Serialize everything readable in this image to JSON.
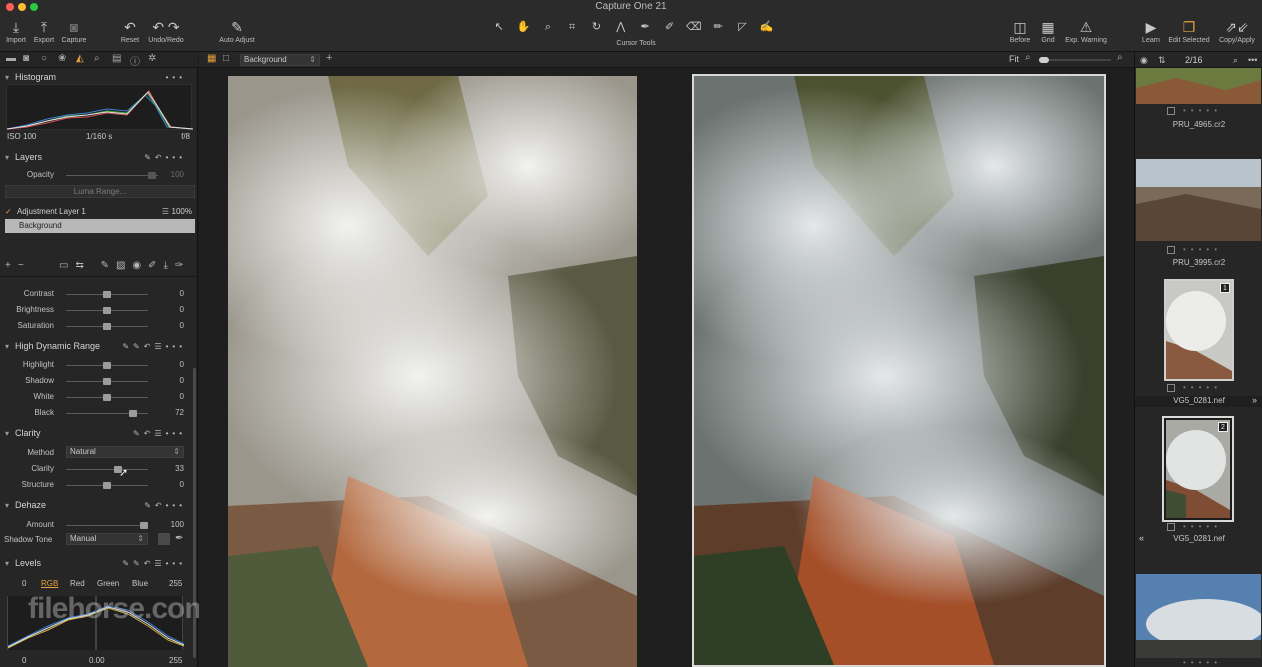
{
  "window": {
    "title": "Capture One 21"
  },
  "toolbar": {
    "left": [
      {
        "icon": "import-icon",
        "label": "Import"
      },
      {
        "icon": "export-icon",
        "label": "Export"
      },
      {
        "icon": "capture-icon",
        "label": "Capture"
      },
      {
        "icon": "reset-icon",
        "label": "Reset"
      },
      {
        "icon": "undo-redo-icon",
        "label": "Undo/Redo"
      },
      {
        "icon": "auto-adjust-icon",
        "label": "Auto Adjust"
      }
    ],
    "cursor_tools_label": "Cursor Tools",
    "right": [
      {
        "icon": "before-icon",
        "label": "Before"
      },
      {
        "icon": "grid-icon",
        "label": "Grid"
      },
      {
        "icon": "exposure-warning-icon",
        "label": "Exp. Warning"
      },
      {
        "icon": "learn-icon",
        "label": "Learn"
      },
      {
        "icon": "edit-selected-icon",
        "label": "Edit Selected"
      },
      {
        "icon": "copy-apply-icon",
        "label": "Copy/Apply"
      }
    ]
  },
  "histogram": {
    "title": "Histogram",
    "iso": "ISO 100",
    "shutter": "1/160 s",
    "aperture": "f/8"
  },
  "layers": {
    "title": "Layers",
    "opacity_label": "Opacity",
    "opacity_value": "100",
    "luma_button": "Luma Range...",
    "adjustment_layer": "Adjustment Layer 1",
    "adjustment_value": "100%",
    "background_layer": "Background"
  },
  "basic": {
    "contrast": {
      "label": "Contrast",
      "value": "0"
    },
    "brightness": {
      "label": "Brightness",
      "value": "0"
    },
    "saturation": {
      "label": "Saturation",
      "value": "0"
    }
  },
  "hdr": {
    "title": "High Dynamic Range",
    "highlight": {
      "label": "Highlight",
      "value": "0"
    },
    "shadow": {
      "label": "Shadow",
      "value": "0"
    },
    "white": {
      "label": "White",
      "value": "0"
    },
    "black": {
      "label": "Black",
      "value": "72"
    }
  },
  "clarity": {
    "title": "Clarity",
    "method_label": "Method",
    "method_value": "Natural",
    "clarity": {
      "label": "Clarity",
      "value": "33"
    },
    "structure": {
      "label": "Structure",
      "value": "0"
    }
  },
  "dehaze": {
    "title": "Dehaze",
    "amount": {
      "label": "Amount",
      "value": "100"
    },
    "shadow_tone_label": "Shadow Tone",
    "shadow_tone_value": "Manual"
  },
  "levels": {
    "title": "Levels",
    "left_value": "0",
    "right_value": "255",
    "channels": [
      "RGB",
      "Red",
      "Green",
      "Blue"
    ],
    "bottom_left": "0",
    "bottom_mid": "0.00",
    "bottom_right": "255"
  },
  "viewer": {
    "layer_select": "Background",
    "zoom_label": "Fit"
  },
  "browser": {
    "counter": "2/16",
    "items": [
      {
        "name": "PRU_4965.cr2"
      },
      {
        "name": "PRU_3995.cr2"
      },
      {
        "name": "VG5_0281.nef",
        "badge": "1"
      },
      {
        "name": "VG5_0281.nef",
        "badge": "2"
      }
    ]
  },
  "watermark": "filehorse.com",
  "colors": {
    "accent": "#e8a23a",
    "panel": "#262626",
    "toolbar": "#2b2b2b"
  }
}
